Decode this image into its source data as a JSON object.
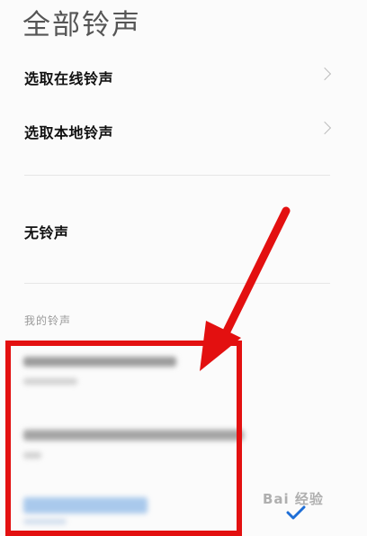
{
  "header": {
    "title": "全部铃声"
  },
  "menu": {
    "online": "选取在线铃声",
    "local": "选取本地铃声",
    "none": "无铃声"
  },
  "section": {
    "my_ringtones": "我的铃声"
  },
  "watermark": {
    "text": "Bai 经验"
  },
  "colors": {
    "highlight": "#e31010",
    "check": "#1e6ed6"
  }
}
